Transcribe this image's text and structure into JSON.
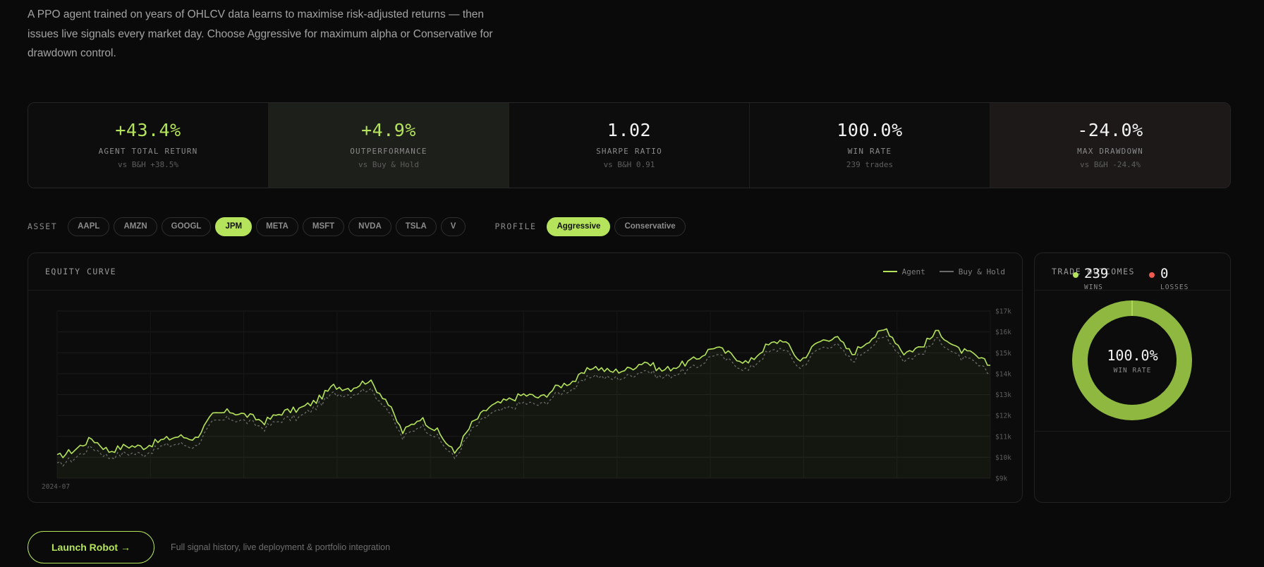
{
  "intro": "A PPO agent trained on years of OHLCV data learns to maximise risk-adjusted returns — then issues live signals every market day. Choose Aggressive for maximum alpha or Conservative for drawdown control.",
  "stats": [
    {
      "value": "+43.4%",
      "label": "AGENT TOTAL RETURN",
      "sub": "vs B&H +38.5%"
    },
    {
      "value": "+4.9%",
      "label": "OUTPERFORMANCE",
      "sub": "vs Buy & Hold"
    },
    {
      "value": "1.02",
      "label": "SHARPE RATIO",
      "sub": "vs B&H 0.91"
    },
    {
      "value": "100.0%",
      "label": "WIN RATE",
      "sub": "239 trades"
    },
    {
      "value": "-24.0%",
      "label": "MAX DRAWDOWN",
      "sub": "vs B&H -24.4%"
    }
  ],
  "selectors": {
    "asset_label": "ASSET",
    "assets": [
      "AAPL",
      "AMZN",
      "GOOGL",
      "JPM",
      "META",
      "MSFT",
      "NVDA",
      "TSLA",
      "V"
    ],
    "selected_asset": "JPM",
    "profile_label": "PROFILE",
    "profiles": [
      "Aggressive",
      "Conservative"
    ],
    "selected_profile": "Aggressive"
  },
  "equity_panel": {
    "title": "EQUITY CURVE",
    "legend_agent": "Agent",
    "legend_bh": "Buy & Hold"
  },
  "chart_data": {
    "type": "line",
    "x_start_label": "2024-07",
    "y_ticks": [
      "$9k",
      "$10k",
      "$11k",
      "$12k",
      "$13k",
      "$14k",
      "$15k",
      "$16k",
      "$17k"
    ],
    "ylim": [
      9000,
      17000
    ],
    "grid": true,
    "series": [
      {
        "name": "Agent",
        "color": "#b5e45c",
        "values": [
          10000,
          10350,
          10900,
          10300,
          10550,
          10500,
          10800,
          11000,
          10900,
          12000,
          12200,
          12000,
          11700,
          12150,
          12300,
          12700,
          13400,
          13300,
          13700,
          12800,
          11200,
          11900,
          11250,
          10200,
          11600,
          12400,
          12700,
          13000,
          12850,
          13400,
          13700,
          14350,
          14100,
          14200,
          14600,
          14150,
          14400,
          14700,
          15300,
          14900,
          14500,
          15300,
          15650,
          14600,
          15500,
          15800,
          14950,
          15650,
          16150,
          15000,
          15300,
          16050,
          15200,
          14900,
          14400
        ]
      },
      {
        "name": "Buy & Hold",
        "color": "#6a6a6a",
        "values": [
          9600,
          9950,
          10500,
          10000,
          10200,
          10150,
          10500,
          10650,
          10500,
          11650,
          11850,
          11700,
          11400,
          11800,
          11900,
          12400,
          13050,
          13000,
          13300,
          12450,
          10900,
          11550,
          10950,
          9950,
          11300,
          12050,
          12300,
          12600,
          12500,
          13050,
          13350,
          13950,
          13750,
          13850,
          14200,
          13800,
          14050,
          14300,
          14950,
          14550,
          14150,
          14950,
          15250,
          14250,
          15150,
          15450,
          14600,
          15300,
          15800,
          14650,
          14950,
          15700,
          14850,
          14550,
          14000
        ]
      }
    ]
  },
  "outcomes": {
    "title": "TRADE OUTCOMES",
    "win_rate": "100.0%",
    "win_rate_label": "WIN RATE",
    "wins": "239",
    "wins_label": "WINS",
    "losses": "0",
    "losses_label": "LOSSES",
    "win_fraction": 1.0,
    "win_color": "#8fb840",
    "loss_color": "#ef5a4f"
  },
  "launch": {
    "button": "Launch Robot →",
    "note": "Full signal history, live deployment & portfolio integration"
  }
}
